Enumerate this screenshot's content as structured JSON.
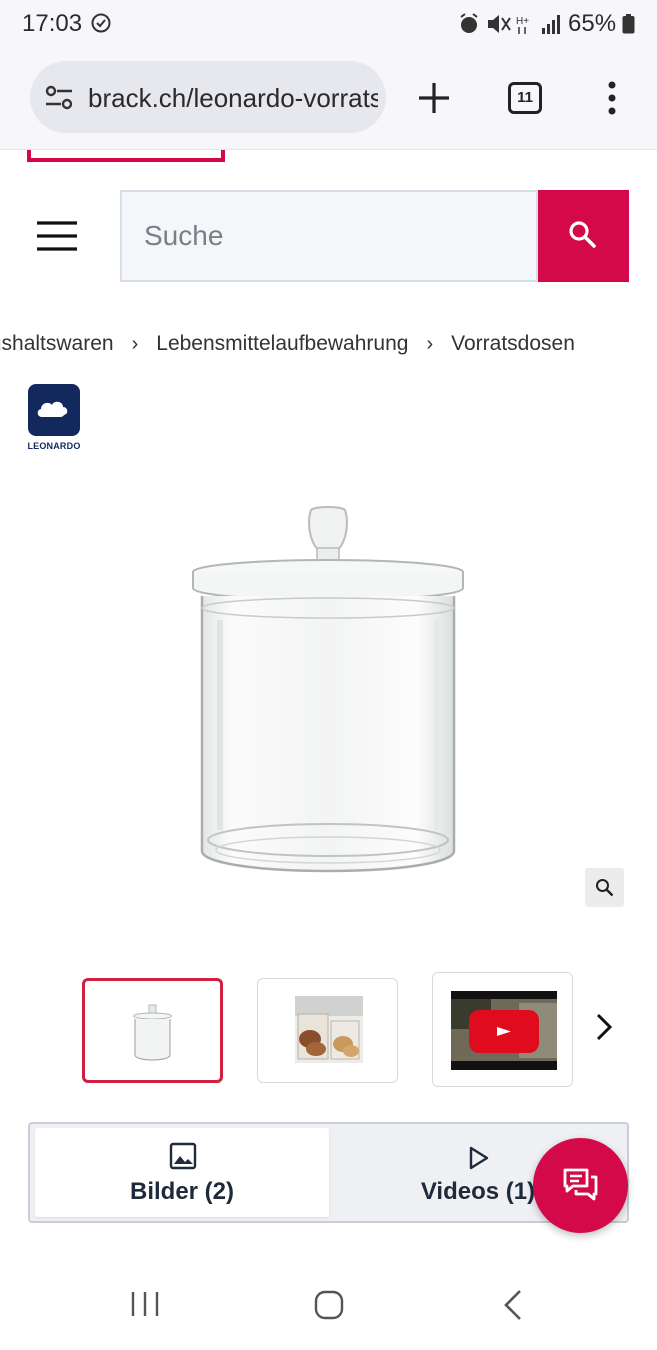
{
  "status_bar": {
    "time": "17:03",
    "battery": "65%"
  },
  "browser": {
    "url": "brack.ch/leonardo-vorratsdose",
    "tab_count": "11"
  },
  "header": {
    "search_placeholder": "Suche",
    "accent_color": "#d4094a"
  },
  "breadcrumb": [
    "Haushaltswaren",
    "Lebensmittelaufbewahrung",
    "Vorratsdosen"
  ],
  "brand": {
    "name": "LEONARDO"
  },
  "gallery": {
    "thumbnails": [
      {
        "kind": "image",
        "icon": "glass-jar-thumb"
      },
      {
        "kind": "image",
        "icon": "jars-with-cookies-thumb"
      },
      {
        "kind": "video",
        "icon": "youtube-play-icon"
      }
    ]
  },
  "media_tabs": {
    "images_label": "Bilder (2)",
    "videos_label": "Videos (1)"
  }
}
